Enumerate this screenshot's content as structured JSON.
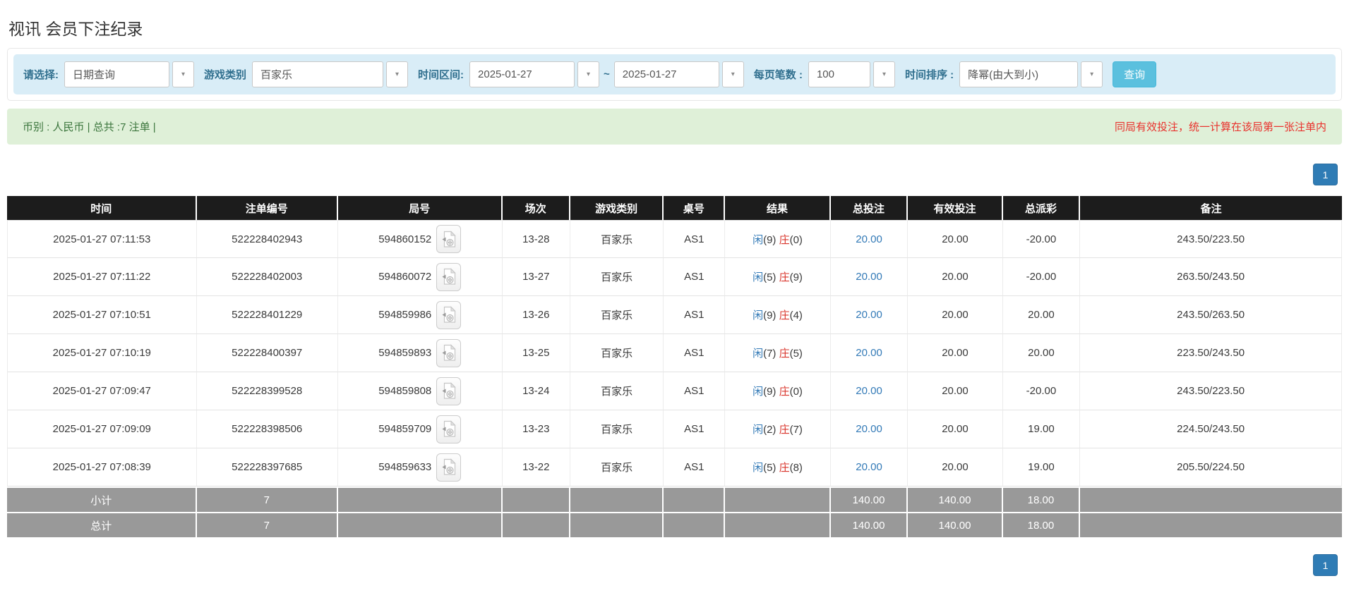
{
  "page": {
    "title": "视讯 会员下注纪录"
  },
  "filters": {
    "select_label": "请选择:",
    "select_value": "日期查询",
    "game_label": "游戏类别",
    "game_value": "百家乐",
    "range_label": "时间区间:",
    "range_from": "2025-01-27",
    "tilde": "~",
    "range_to": "2025-01-27",
    "per_page_label": "每页笔数 :",
    "per_page_value": "100",
    "sort_label": "时间排序 :",
    "sort_value": "降幂(由大到小)",
    "search_button": "查询",
    "chevron_icon": "▾"
  },
  "summary": {
    "left": "币别 : 人民币 | 总共 :7 注单 |",
    "right_note": "同局有效投注，统一计算在该局第一张注单内"
  },
  "pagination": {
    "page": "1"
  },
  "table": {
    "headers": [
      "时间",
      "注单编号",
      "局号",
      "场次",
      "游戏类别",
      "桌号",
      "结果",
      "总投注",
      "有效投注",
      "总派彩",
      "备注"
    ],
    "rows": [
      {
        "time": "2025-01-27 07:11:53",
        "bet_id": "522228402943",
        "round_id": "594860152",
        "session": "13-28",
        "game": "百家乐",
        "table_no": "AS1",
        "player_label": "闲",
        "player_score": "(9)",
        "banker_label": "庄",
        "banker_score": "(0)",
        "total_bet": "20.00",
        "valid_bet": "20.00",
        "payout": "-20.00",
        "remark": "243.50/223.50"
      },
      {
        "time": "2025-01-27 07:11:22",
        "bet_id": "522228402003",
        "round_id": "594860072",
        "session": "13-27",
        "game": "百家乐",
        "table_no": "AS1",
        "player_label": "闲",
        "player_score": "(5)",
        "banker_label": "庄",
        "banker_score": "(9)",
        "total_bet": "20.00",
        "valid_bet": "20.00",
        "payout": "-20.00",
        "remark": "263.50/243.50"
      },
      {
        "time": "2025-01-27 07:10:51",
        "bet_id": "522228401229",
        "round_id": "594859986",
        "session": "13-26",
        "game": "百家乐",
        "table_no": "AS1",
        "player_label": "闲",
        "player_score": "(9)",
        "banker_label": "庄",
        "banker_score": "(4)",
        "total_bet": "20.00",
        "valid_bet": "20.00",
        "payout": "20.00",
        "remark": "243.50/263.50"
      },
      {
        "time": "2025-01-27 07:10:19",
        "bet_id": "522228400397",
        "round_id": "594859893",
        "session": "13-25",
        "game": "百家乐",
        "table_no": "AS1",
        "player_label": "闲",
        "player_score": "(7)",
        "banker_label": "庄",
        "banker_score": "(5)",
        "total_bet": "20.00",
        "valid_bet": "20.00",
        "payout": "20.00",
        "remark": "223.50/243.50"
      },
      {
        "time": "2025-01-27 07:09:47",
        "bet_id": "522228399528",
        "round_id": "594859808",
        "session": "13-24",
        "game": "百家乐",
        "table_no": "AS1",
        "player_label": "闲",
        "player_score": "(9)",
        "banker_label": "庄",
        "banker_score": "(0)",
        "total_bet": "20.00",
        "valid_bet": "20.00",
        "payout": "-20.00",
        "remark": "243.50/223.50"
      },
      {
        "time": "2025-01-27 07:09:09",
        "bet_id": "522228398506",
        "round_id": "594859709",
        "session": "13-23",
        "game": "百家乐",
        "table_no": "AS1",
        "player_label": "闲",
        "player_score": "(2)",
        "banker_label": "庄",
        "banker_score": "(7)",
        "total_bet": "20.00",
        "valid_bet": "20.00",
        "payout": "19.00",
        "remark": "224.50/243.50"
      },
      {
        "time": "2025-01-27 07:08:39",
        "bet_id": "522228397685",
        "round_id": "594859633",
        "session": "13-22",
        "game": "百家乐",
        "table_no": "AS1",
        "player_label": "闲",
        "player_score": "(5)",
        "banker_label": "庄",
        "banker_score": "(8)",
        "total_bet": "20.00",
        "valid_bet": "20.00",
        "payout": "19.00",
        "remark": "205.50/224.50"
      }
    ],
    "subtotal": {
      "label": "小计",
      "count": "7",
      "total_bet": "140.00",
      "valid_bet": "140.00",
      "payout": "18.00"
    },
    "total": {
      "label": "总计",
      "count": "7",
      "total_bet": "140.00",
      "valid_bet": "140.00",
      "payout": "18.00"
    }
  },
  "colors": {
    "filter_bar_bg": "#d9edf7",
    "filter_label": "#31708f",
    "search_button_bg": "#5bc0de",
    "summary_bg": "#dff0d8",
    "summary_text": "#3c763d",
    "alert_red": "#e9322d",
    "link_blue": "#337ab7",
    "banker_red": "#d9342b",
    "header_bg": "#1c1c1c",
    "summary_row_bg": "#999999",
    "pager_blue": "#2f7cb5"
  }
}
